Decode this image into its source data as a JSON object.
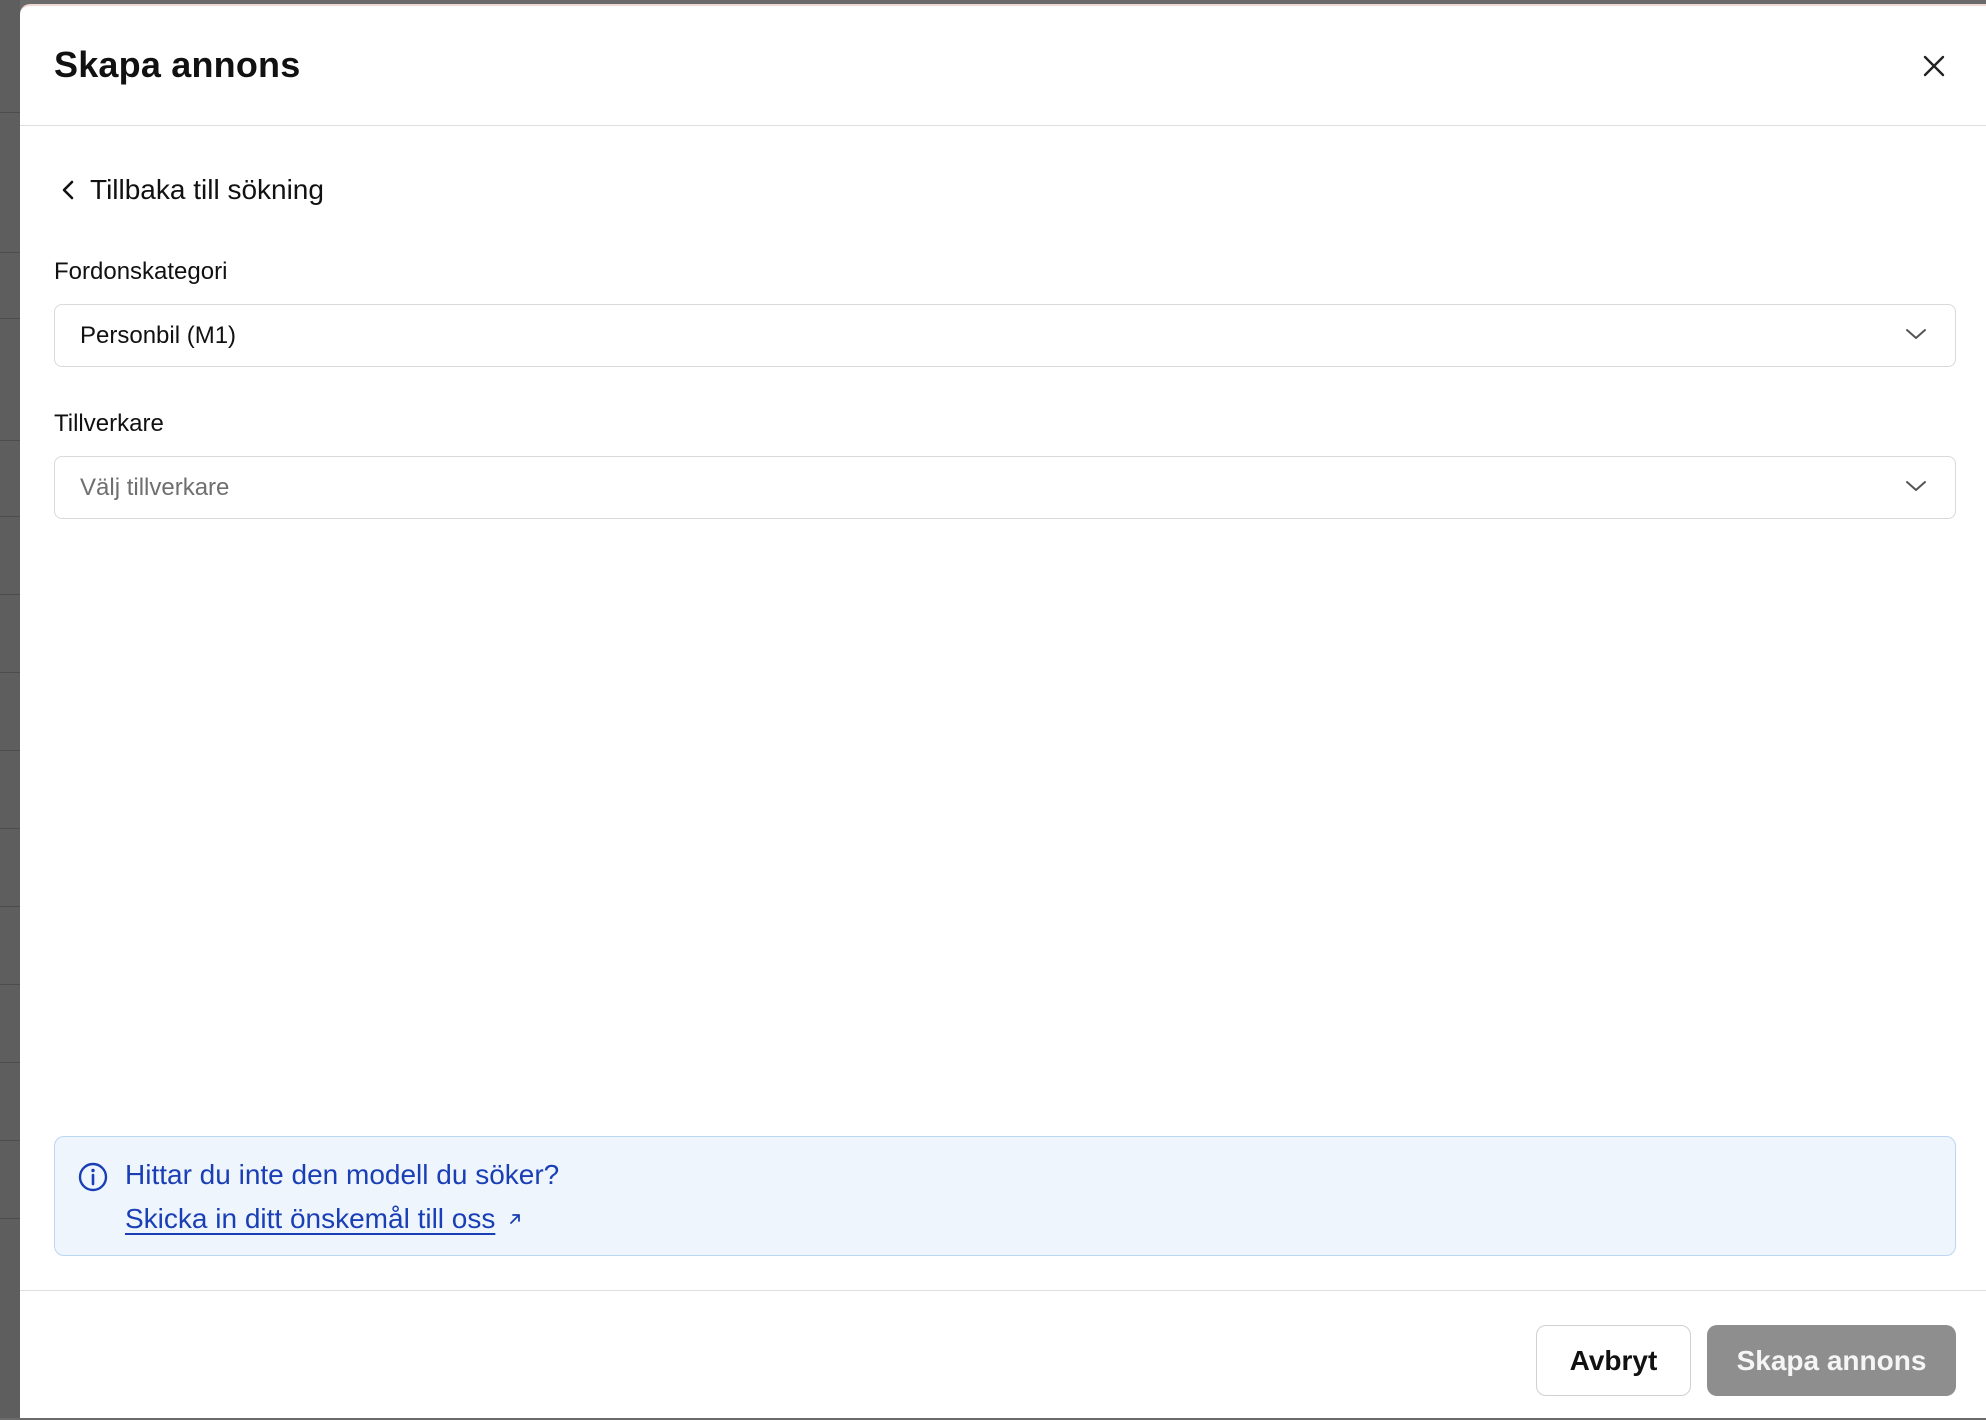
{
  "dialog": {
    "title": "Skapa annons",
    "close_icon": "close-icon"
  },
  "back": {
    "label": "Tillbaka till sökning",
    "icon": "chevron-left-icon"
  },
  "fields": {
    "category": {
      "label": "Fordonskategori",
      "value": "Personbil (M1)"
    },
    "manufacturer": {
      "label": "Tillverkare",
      "placeholder": "Välj tillverkare"
    }
  },
  "info": {
    "title": "Hittar du inte den modell du söker?",
    "link": "Skicka in ditt önskemål till oss",
    "colors": {
      "text": "#1a3fb5",
      "background": "#eef5fd",
      "border": "#bcd6f3"
    }
  },
  "footer": {
    "cancel_label": "Avbryt",
    "submit_label": "Skapa annons",
    "submit_disabled_color": "#8e8e8e"
  }
}
